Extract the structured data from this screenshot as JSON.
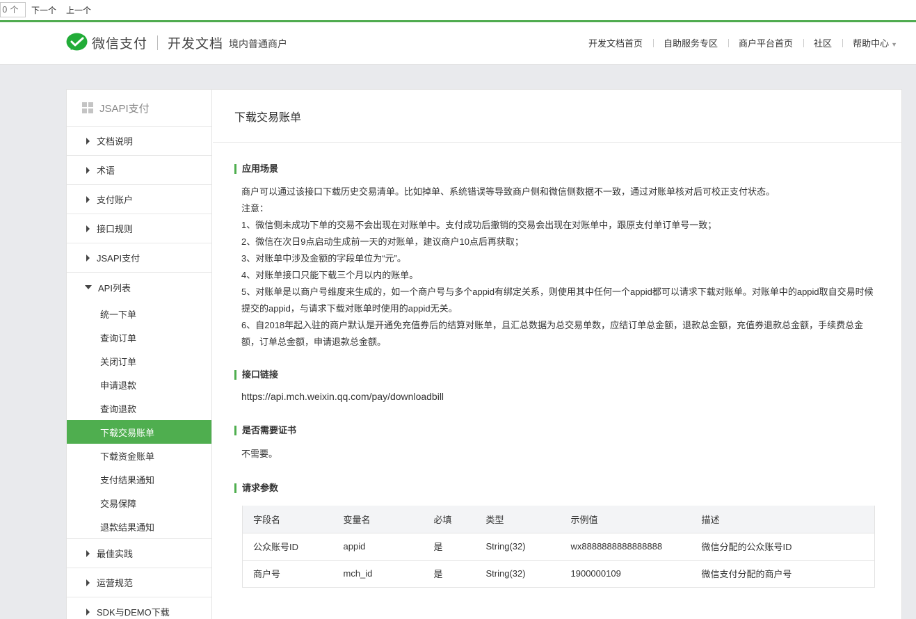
{
  "findbar": {
    "count_placeholder": "0 个",
    "next_label": "下一个",
    "prev_label": "上一个"
  },
  "header": {
    "brand_name": "微信支付",
    "brand_doc": "开发文档",
    "brand_sub": "境内普通商户",
    "nav": [
      "开发文档首页",
      "自助服务专区",
      "商户平台首页",
      "社区",
      "帮助中心"
    ],
    "accent_color": "#4fae4f"
  },
  "sidebar": {
    "title": "JSAPI支付",
    "items_before": [
      "文档说明",
      "术语",
      "支付账户",
      "接口规则",
      "JSAPI支付"
    ],
    "open_item": "API列表",
    "sub_items": [
      "统一下单",
      "查询订单",
      "关闭订单",
      "申请退款",
      "查询退款",
      "下载交易账单",
      "下载资金账单",
      "支付结果通知",
      "交易保障",
      "退款结果通知"
    ],
    "active_sub": "下载交易账单",
    "items_after": [
      "最佳实践",
      "运营规范",
      "SDK与DEMO下载"
    ]
  },
  "content": {
    "title": "下载交易账单",
    "sections": {
      "scene": {
        "heading": "应用场景",
        "lines": [
          "商户可以通过该接口下载历史交易清单。比如掉单、系统错误等导致商户侧和微信侧数据不一致，通过对账单核对后可校正支付状态。",
          "注意：",
          "1、微信侧未成功下单的交易不会出现在对账单中。支付成功后撤销的交易会出现在对账单中，跟原支付单订单号一致；",
          "2、微信在次日9点启动生成前一天的对账单，建议商户10点后再获取；",
          "3、对账单中涉及金额的字段单位为“元”。",
          "4、对账单接口只能下载三个月以内的账单。",
          "5、对账单是以商户号维度来生成的，如一个商户号与多个appid有绑定关系，则使用其中任何一个appid都可以请求下载对账单。对账单中的appid取自交易时候提交的appid，与请求下载对账单时使用的appid无关。",
          "6、自2018年起入驻的商户默认是开通免充值券后的结算对账单，且汇总数据为总交易单数，应结订单总金额，退款总金额，充值券退款总金额，手续费总金额，订单总金额，申请退款总金额。"
        ]
      },
      "link": {
        "heading": "接口链接",
        "url": "https://api.mch.weixin.qq.com/pay/downloadbill"
      },
      "cert": {
        "heading": "是否需要证书",
        "value": "不需要。"
      },
      "params": {
        "heading": "请求参数",
        "columns": [
          "字段名",
          "变量名",
          "必填",
          "类型",
          "示例值",
          "描述"
        ],
        "rows": [
          [
            "公众账号ID",
            "appid",
            "是",
            "String(32)",
            "wx8888888888888888",
            "微信分配的公众账号ID"
          ],
          [
            "商户号",
            "mch_id",
            "是",
            "String(32)",
            "1900000109",
            "微信支付分配的商户号"
          ]
        ]
      }
    }
  }
}
